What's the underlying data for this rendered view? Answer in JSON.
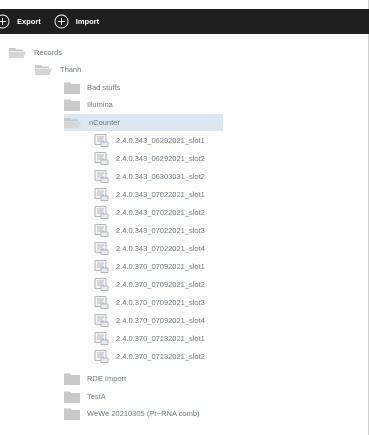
{
  "toolbar": {
    "export_label": "Export",
    "import_label": "Import",
    "icons": {
      "export": "plus-circle-icon",
      "import": "plus-circle-icon"
    }
  },
  "colors": {
    "toolbar_bg": "#1e1e1e",
    "selected_bg": "#dbe8f1",
    "folder": "#c9c9c9",
    "text": "#6f7880"
  },
  "tree": {
    "root": {
      "label": "Records",
      "icon": "folder-open-icon"
    },
    "user": {
      "label": "Thanh",
      "icon": "folder-open-icon"
    },
    "folders_before": [
      {
        "label": "Bad stuffs",
        "icon": "folder-icon"
      },
      {
        "label": "Illumina",
        "icon": "folder-icon"
      }
    ],
    "selected_folder": {
      "label": "nCounter",
      "icon": "folder-open-icon"
    },
    "records": [
      "2.4.0.343_06292021_slot1",
      "2.4.0.343_06292021_slot2",
      "2.4.0.343_06303031_slot2",
      "2.4.0.343_07022021_slot1",
      "2.4.0.343_07022021_slot2",
      "2.4.0.343_07022021_slot3",
      "2.4.0.343_07022021_slot4",
      "2.4.0.370_07092021_slot1",
      "2.4.0.370_07092021_slot2",
      "2.4.0.370_07092021_slot3",
      "2.4.0.370_07092021_slot4",
      "2.4.0.370_07132021_slot1",
      "2.4.0.370_07132021_slot2"
    ],
    "folders_after": [
      {
        "label": "RDE Import",
        "icon": "folder-icon"
      },
      {
        "label": "TestA",
        "icon": "folder-icon"
      },
      {
        "label": "WeWe 20210305 (Pr~RNA comb)",
        "icon": "folder-icon"
      }
    ]
  }
}
